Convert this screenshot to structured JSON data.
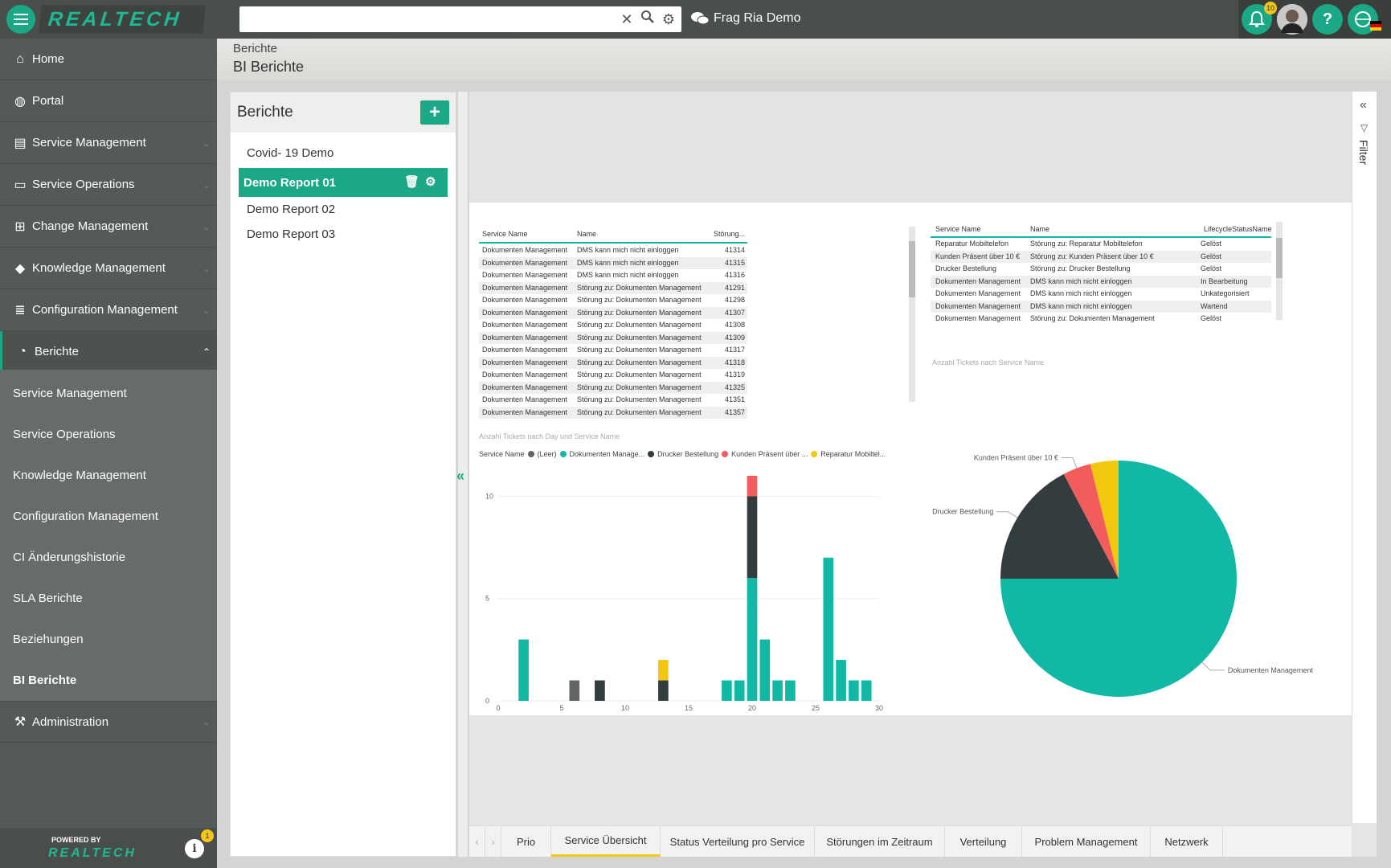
{
  "topbar": {
    "brand": "REALTECH",
    "search_value": "",
    "chat_label": "Frag Ria Demo",
    "notification_count": "10"
  },
  "sidebar": {
    "items": [
      {
        "label": "Home",
        "icon": "home-icon"
      },
      {
        "label": "Portal",
        "icon": "globe-icon"
      },
      {
        "label": "Service Management",
        "icon": "book-icon"
      },
      {
        "label": "Service Operations",
        "icon": "server-icon"
      },
      {
        "label": "Change Management",
        "icon": "sitemap-icon"
      },
      {
        "label": "Knowledge Management",
        "icon": "graduation-cap-icon"
      },
      {
        "label": "Configuration Management",
        "icon": "database-icon"
      },
      {
        "label": "Berichte",
        "icon": "pie-chart-icon"
      }
    ],
    "sub_items": [
      "Service Management",
      "Service Operations",
      "Knowledge Management",
      "Configuration Management",
      "CI Änderungshistorie",
      "SLA Berichte",
      "Beziehungen",
      "BI Berichte"
    ],
    "admin_label": "Administration",
    "powered_by": "POWERED BY",
    "footer_brand": "REALTECH",
    "info_badge": "1"
  },
  "header": {
    "breadcrumb": "Berichte",
    "title": "BI Berichte"
  },
  "reports_panel": {
    "title": "Berichte",
    "items": [
      "Covid- 19 Demo",
      "Demo Report 01",
      "Demo Report 02",
      "Demo Report 03"
    ],
    "selected": "Demo Report 01"
  },
  "table_left": {
    "headers": [
      "Service Name",
      "Name",
      "Störung..."
    ],
    "rows": [
      [
        "Dokumenten Management",
        "DMS kann mich nicht einloggen",
        "41314"
      ],
      [
        "Dokumenten Management",
        "DMS kann mich nicht einloggen",
        "41315"
      ],
      [
        "Dokumenten Management",
        "DMS kann mich nicht einloggen",
        "41316"
      ],
      [
        "Dokumenten Management",
        "Störung zu: Dokumenten Management",
        "41291"
      ],
      [
        "Dokumenten Management",
        "Störung zu: Dokumenten Management",
        "41298"
      ],
      [
        "Dokumenten Management",
        "Störung zu: Dokumenten Management",
        "41307"
      ],
      [
        "Dokumenten Management",
        "Störung zu: Dokumenten Management",
        "41308"
      ],
      [
        "Dokumenten Management",
        "Störung zu: Dokumenten Management",
        "41309"
      ],
      [
        "Dokumenten Management",
        "Störung zu: Dokumenten Management",
        "41317"
      ],
      [
        "Dokumenten Management",
        "Störung zu: Dokumenten Management",
        "41318"
      ],
      [
        "Dokumenten Management",
        "Störung zu: Dokumenten Management",
        "41319"
      ],
      [
        "Dokumenten Management",
        "Störung zu: Dokumenten Management",
        "41325"
      ],
      [
        "Dokumenten Management",
        "Störung zu: Dokumenten Management",
        "41351"
      ],
      [
        "Dokumenten Management",
        "Störung zu: Dokumenten Management",
        "41357"
      ]
    ]
  },
  "table_right": {
    "headers": [
      "Service Name",
      "Name",
      "LifecycleStatusName"
    ],
    "rows": [
      [
        "Reparatur Mobiltelefon",
        "Störung zu: Reparatur Mobiltelefon",
        "Gelöst"
      ],
      [
        "Kunden Präsent über 10 €",
        "Störung zu: Kunden Präsent über 10 €",
        "Gelöst"
      ],
      [
        "Drucker Bestellung",
        "Störung zu: Drucker Bestellung",
        "Gelöst"
      ],
      [
        "Dokumenten Management",
        "DMS kann mich nicht einloggen",
        "In Bearbeitung"
      ],
      [
        "Dokumenten Management",
        "DMS kann mich nicht einloggen",
        "Unkategorisiert"
      ],
      [
        "Dokumenten Management",
        "DMS kann mich nicht einloggen",
        "Wartend"
      ],
      [
        "Dokumenten Management",
        "Störung zu: Dokumenten Management",
        "Gelöst"
      ]
    ]
  },
  "chart_data": [
    {
      "type": "bar",
      "title": "Anzahl Tickets nach Day und Service Name",
      "legend_title": "Service Name",
      "legend_text": [
        "(Leer)",
        "Dokumenten Manage...",
        "Drucker Bestellung",
        "Kunden Präsent über ...",
        "Reparatur Mobiltel..."
      ],
      "legend_colors": [
        "#5f6663",
        "#12b8a6",
        "#333c3e",
        "#f25c5c",
        "#f2c80f"
      ],
      "stacked": true,
      "xlim": [
        0,
        30
      ],
      "ylim": [
        0,
        11
      ],
      "x_ticks": [
        0,
        5,
        10,
        15,
        20,
        25,
        30
      ],
      "y_ticks": [
        0,
        5,
        10
      ],
      "series": [
        {
          "name": "(Leer)",
          "color": "#5f6663",
          "points": [
            [
              6,
              1
            ]
          ]
        },
        {
          "name": "Dokumenten Management",
          "color": "#12b8a6",
          "points": [
            [
              2,
              3
            ],
            [
              18,
              1
            ],
            [
              19,
              1
            ],
            [
              20,
              6
            ],
            [
              21,
              3
            ],
            [
              22,
              1
            ],
            [
              23,
              1
            ],
            [
              26,
              7
            ],
            [
              27,
              2
            ],
            [
              28,
              1
            ],
            [
              29,
              1
            ]
          ]
        },
        {
          "name": "Drucker Bestellung",
          "color": "#333c3e",
          "points": [
            [
              8,
              1
            ],
            [
              13,
              1
            ],
            [
              20,
              4
            ]
          ]
        },
        {
          "name": "Kunden Präsent über 10 €",
          "color": "#f25c5c",
          "points": [
            [
              20,
              1
            ]
          ]
        },
        {
          "name": "Reparatur Mobiltelefon",
          "color": "#f2c80f",
          "points": [
            [
              13,
              1
            ]
          ]
        }
      ]
    },
    {
      "type": "pie",
      "title": "Anzahl Tickets nach Service Name",
      "categories": [
        "Dokumenten Management",
        "Drucker Bestellung",
        "Kunden Präsent über 10 €",
        "Reparatur Mobiltelefon"
      ],
      "values": [
        39,
        9,
        2,
        2
      ],
      "colors": [
        "#12b8a6",
        "#333c3e",
        "#f25c5c",
        "#f2c80f"
      ],
      "labels": [
        "Dokumenten Management",
        "Drucker Bestellung",
        "Kunden Präsent über 10 €"
      ]
    }
  ],
  "tabs": [
    "Prio",
    "Service Übersicht",
    "Status Verteilung pro Service",
    "Störungen im Zeitraum",
    "Verteilung",
    "Problem Management",
    "Netzwerk"
  ],
  "active_tab": "Service Übersicht",
  "filter_label": "Filter",
  "colors": {
    "accent": "#1aa886",
    "sidebar": "#555a56",
    "tab_active": "#f5c518"
  }
}
